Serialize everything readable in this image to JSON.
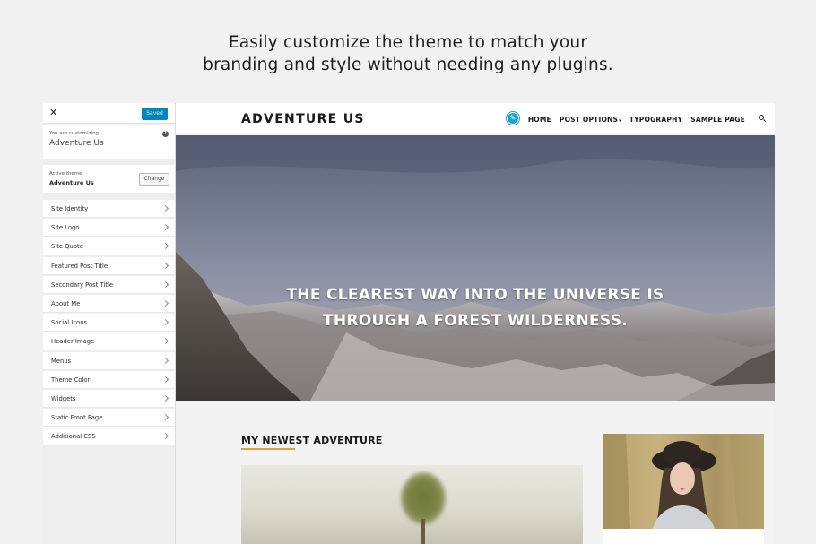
{
  "headline": {
    "line1": "Easily customize the theme to match your",
    "line2": "branding and style without needing any plugins."
  },
  "customizer": {
    "close_glyph": "✕",
    "saved_label": "Saved",
    "customizing_label": "You are customizing",
    "site_name": "Adventure Us",
    "help_glyph": "?",
    "active_theme_label": "Active theme",
    "active_theme_name": "Adventure Us",
    "change_label": "Change",
    "sections": [
      "Site Identity",
      "Site Logo",
      "Site Quote",
      "Featured Post Title",
      "Secondary Post Title",
      "About Me",
      "Social Icons",
      "Header Image",
      "Menus",
      "Theme Color",
      "Widgets",
      "Static Front Page",
      "Additional CSS"
    ]
  },
  "site": {
    "logo": "ADVENTURE US",
    "nav": {
      "home": "HOME",
      "post_options": "POST OPTIONS",
      "typography": "TYPOGRAPHY",
      "sample_page": "SAMPLE PAGE"
    },
    "hero_line1": "THE CLEAREST WAY INTO THE UNIVERSE IS",
    "hero_line2": "THROUGH A FOREST WILDERNESS.",
    "section_title": "MY NEWEST ADVENTURE"
  },
  "colors": {
    "accent": "#0085ba",
    "edit_shortcut": "#1ea1d4",
    "title_underline": "#e0a23d"
  },
  "icons": [
    "close-icon",
    "help-icon",
    "chevron-right-icon",
    "pencil-icon",
    "search-icon",
    "caret-down-icon"
  ]
}
